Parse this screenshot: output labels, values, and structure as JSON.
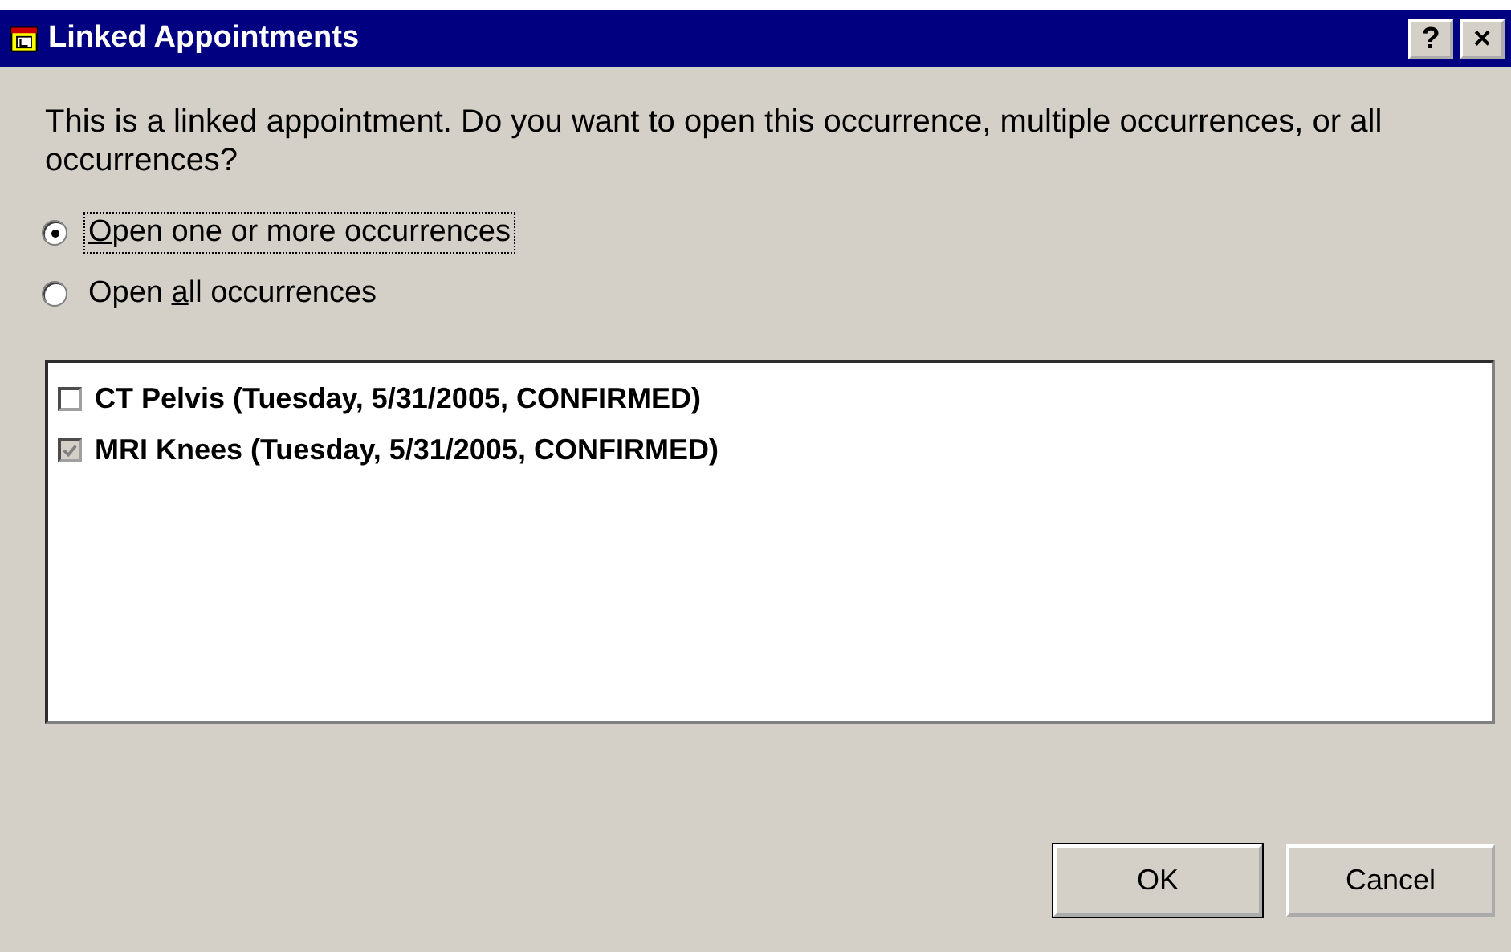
{
  "window": {
    "title": "Linked Appointments",
    "help_button": "?",
    "close_button": "×"
  },
  "message": "This is a linked appointment. Do you want to open this occurrence, multiple occurrences, or all occurrences?",
  "options": [
    {
      "access_key": "O",
      "label_after": "pen one or more occurrences",
      "selected": true,
      "focused": true
    },
    {
      "label_before": "Open ",
      "access_key": "a",
      "label_after": "ll occurrences",
      "selected": false,
      "focused": false
    }
  ],
  "occurrences": [
    {
      "label": "CT Pelvis (Tuesday, 5/31/2005, CONFIRMED)",
      "checked": false,
      "disabled": false
    },
    {
      "label": "MRI Knees (Tuesday, 5/31/2005, CONFIRMED)",
      "checked": true,
      "disabled": true
    }
  ],
  "buttons": [
    {
      "label": "OK",
      "default": true
    },
    {
      "label": "Cancel",
      "default": false
    }
  ]
}
